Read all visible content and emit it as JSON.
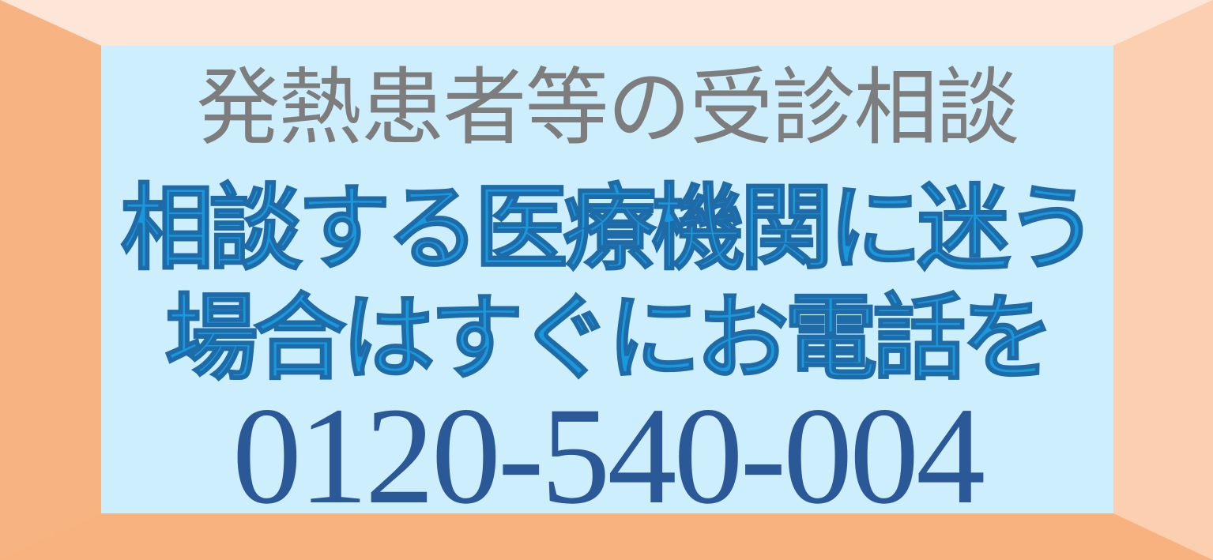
{
  "banner": {
    "subtitle": "発熱患者等の受診相談",
    "headline_line1": "相談する医療機関に迷う",
    "headline_line2": "場合はすぐにお電話を",
    "phone_number": "0120-540-004"
  },
  "colors": {
    "frame_top": "#fde6d8",
    "frame_left": "#f8b383",
    "frame_bottom": "#f7b27f",
    "frame_right": "#fbcfb0",
    "panel_background": "#cdeefc",
    "subtitle_text": "#7d7d7d",
    "headline_text": "#1899dd",
    "headline_outline": "#1f6ba8",
    "phone_text": "#2b5897"
  }
}
